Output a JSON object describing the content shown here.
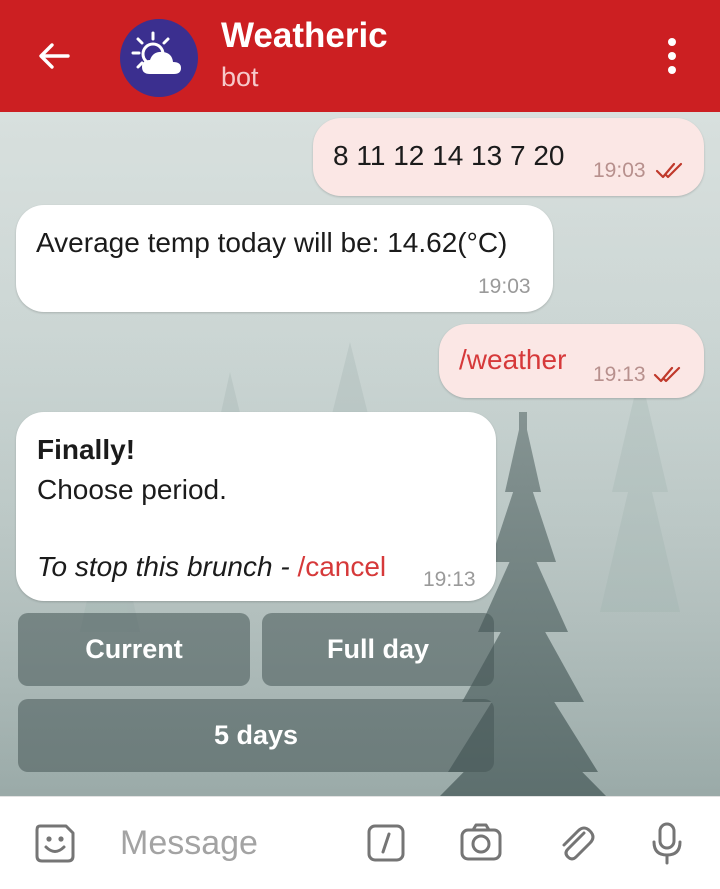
{
  "header": {
    "title": "Weatheric",
    "subtitle": "bot",
    "back_icon": "arrow-left-icon",
    "avatar_icon": "sun-cloud-icon",
    "menu_icon": "more-vertical-icon",
    "color": "#cc1f22"
  },
  "messages": [
    {
      "direction": "outgoing",
      "text": "8 11 12 14 13 7 20",
      "time": "19:03",
      "status": "read"
    },
    {
      "direction": "incoming",
      "text": "Average temp today will be: 14.62(°C)",
      "time": "19:03"
    },
    {
      "direction": "outgoing",
      "text": "/weather",
      "time": "19:13",
      "status": "read"
    },
    {
      "direction": "incoming",
      "title": "Finally!",
      "line": "Choose period.",
      "hint_prefix": "To stop this brunch - ",
      "hint_command": "/cancel",
      "time": "19:13"
    }
  ],
  "keyboard": {
    "buttons": [
      "Current",
      "Full day",
      "5 days"
    ]
  },
  "input": {
    "placeholder": "Message",
    "icons": [
      "sticker-icon",
      "bot-command-icon",
      "camera-icon",
      "attach-icon",
      "mic-icon"
    ]
  },
  "colors": {
    "outgoing_bubble": "#fbe7e5",
    "incoming_bubble": "#ffffff",
    "command_link": "#d6393a"
  }
}
